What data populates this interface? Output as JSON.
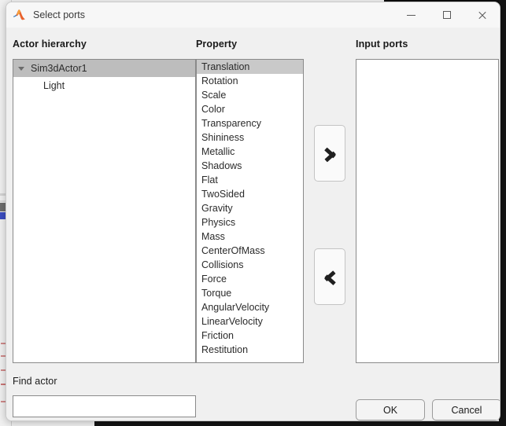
{
  "window": {
    "title": "Select ports",
    "icon": "matlab-membrane-icon",
    "controls": {
      "minimize": "Minimize",
      "maximize": "Maximize",
      "close": "Close"
    }
  },
  "columns": {
    "actor_hierarchy_label": "Actor hierarchy",
    "property_label": "Property",
    "input_ports_label": "Input ports"
  },
  "actor_hierarchy": {
    "nodes": [
      {
        "label": "Sim3dActor1",
        "level": 0,
        "expanded": true,
        "selected": true
      },
      {
        "label": "Light",
        "level": 1,
        "expanded": false,
        "selected": false
      }
    ]
  },
  "property_list": {
    "selected": "Translation",
    "items": [
      "Translation",
      "Rotation",
      "Scale",
      "Color",
      "Transparency",
      "Shininess",
      "Metallic",
      "Shadows",
      "Flat",
      "TwoSided",
      "Gravity",
      "Physics",
      "Mass",
      "CenterOfMass",
      "Collisions",
      "Force",
      "Torque",
      "AngularVelocity",
      "LinearVelocity",
      "Friction",
      "Restitution"
    ]
  },
  "input_ports": {
    "items": []
  },
  "transfer_buttons": {
    "add_label": "chevron-right-icon",
    "remove_label": "chevron-left-icon"
  },
  "find_actor": {
    "label": "Find actor",
    "value": "",
    "placeholder": ""
  },
  "footer": {
    "ok_label": "OK",
    "cancel_label": "Cancel"
  },
  "colors": {
    "dialog_background": "#f0f0f0",
    "titlebar": "#f7f7f7",
    "list_background": "#ffffff",
    "list_border": "#8a8a8a",
    "tree_selection": "#bdbdbd",
    "property_selection": "#c9c9c9",
    "text": "#2b2b2b",
    "desktop_dark": "#141414"
  }
}
